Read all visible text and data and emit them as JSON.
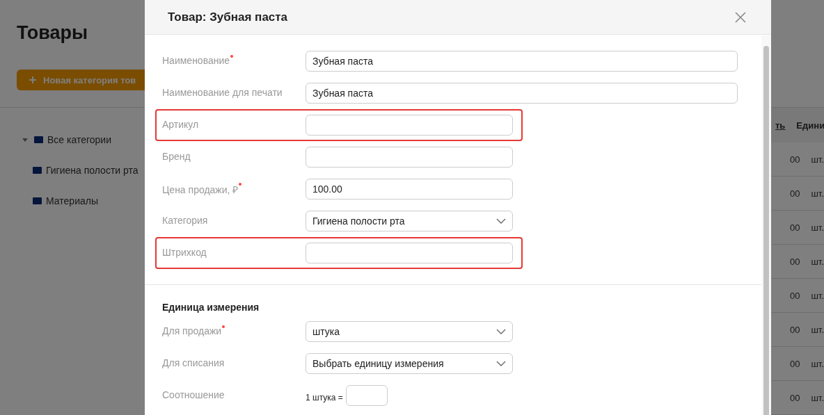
{
  "page": {
    "title": "Товары",
    "new_category_button": "Новая категория тов"
  },
  "category_tree": [
    {
      "label": "Все категории",
      "expanded": true,
      "children": [
        {
          "label": "Гигиена полости рта"
        },
        {
          "label": "Материалы"
        }
      ]
    }
  ],
  "table": {
    "columns": [
      {
        "label": "ть",
        "sortable": true
      },
      {
        "label": "Едини",
        "sortable": false
      }
    ],
    "rows": [
      [
        "00",
        "шт."
      ],
      [
        "00",
        "шт."
      ],
      [
        "00",
        "шт."
      ],
      [
        "00",
        "шт."
      ],
      [
        "00",
        "шт."
      ],
      [
        "00",
        "шт."
      ],
      [
        "00",
        "шт."
      ],
      [
        "00",
        "шт."
      ]
    ]
  },
  "dialog": {
    "title": "Товар: Зубная паста",
    "fields": [
      {
        "label": "Наименование",
        "kind": "text_long",
        "value": "Зубная паста",
        "required": true,
        "highlighted": false
      },
      {
        "label": "Наименование для печати",
        "kind": "text_long",
        "value": "Зубная паста",
        "required": false,
        "highlighted": false
      },
      {
        "label": "Артикул",
        "kind": "text",
        "required": false,
        "highlighted": true
      },
      {
        "label": "Бренд",
        "kind": "text",
        "required": false,
        "highlighted": false
      },
      {
        "label": "Цена продажи, ₽",
        "kind": "text",
        "value": "100.00",
        "required": true,
        "highlighted": false
      },
      {
        "label": "Категория",
        "kind": "select",
        "value": "Гигиена полости рта",
        "required": false,
        "highlighted": false
      },
      {
        "label": "Штрихкод",
        "kind": "text",
        "required": false,
        "highlighted": true
      }
    ],
    "units_heading": "Единица измерения",
    "unit_fields": [
      {
        "label": "Для продажи",
        "kind": "select",
        "value": "штука",
        "required": true,
        "highlighted": false
      },
      {
        "label": "Для списания",
        "kind": "select",
        "value": "Выбрать единицу измерения",
        "required": false,
        "highlighted": false
      },
      {
        "label": "Соотношение",
        "kind": "ratio",
        "prefix": "1 штука =",
        "required": false,
        "highlighted": false
      }
    ]
  }
}
